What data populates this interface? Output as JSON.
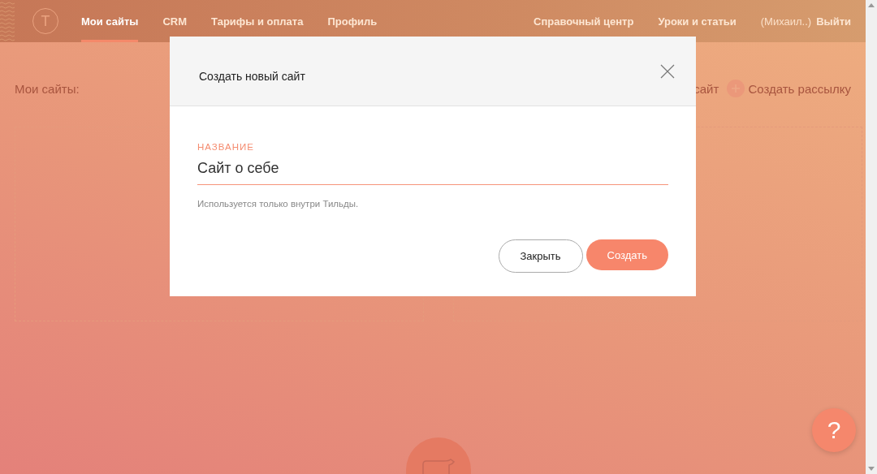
{
  "header": {
    "logo": "Т",
    "nav": [
      {
        "label": "Мои сайты",
        "selected": true
      },
      {
        "label": "CRM",
        "selected": false
      },
      {
        "label": "Тарифы и оплата",
        "selected": false
      },
      {
        "label": "Профиль",
        "selected": false
      }
    ],
    "right_links": [
      "Справочный центр",
      "Уроки и статьи"
    ],
    "user": "(Михаил..)",
    "logout": "Выйти"
  },
  "page": {
    "heading": "Мои сайты:",
    "create_site": "сайт",
    "create_mailing": "Создать рассылку"
  },
  "dialog": {
    "title": "Создать новый сайт",
    "field": {
      "label": "НАЗВАНИЕ",
      "value": "Сайт о себе"
    },
    "hint": "Используется только внутри Тильды.",
    "buttons": [
      {
        "label": "Закрыть",
        "kind": "secondary"
      },
      {
        "label": "Создать",
        "kind": "primary"
      }
    ]
  },
  "help": "?"
}
